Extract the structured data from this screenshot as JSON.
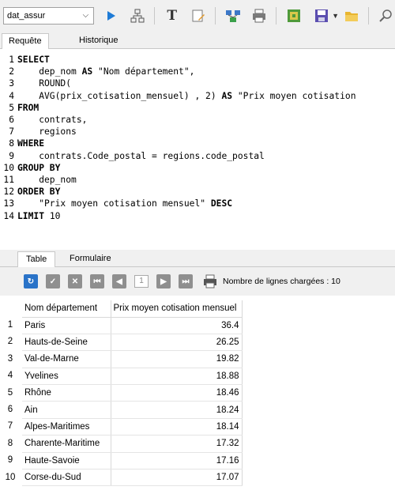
{
  "toolbar": {
    "db_name": "dat_assur",
    "icons": [
      "play-icon",
      "schema-icon",
      "text-icon",
      "clear-icon",
      "query-builder-icon",
      "print-icon",
      "export-icon",
      "save-icon",
      "open-folder-icon",
      "search-icon"
    ]
  },
  "editor_tabs": {
    "request": "Requête",
    "history": "Historique"
  },
  "editor": {
    "lines": [
      {
        "n": "1",
        "parts": [
          {
            "t": "SELECT",
            "k": 1
          }
        ]
      },
      {
        "n": "2",
        "parts": [
          {
            "t": "    dep_nom ",
            "k": 0
          },
          {
            "t": "AS",
            "k": 1
          },
          {
            "t": " \"Nom département\",",
            "k": 0
          }
        ]
      },
      {
        "n": "3",
        "parts": [
          {
            "t": "    ROUND(",
            "k": 0
          }
        ]
      },
      {
        "n": "4",
        "parts": [
          {
            "t": "    AVG(prix_cotisation_mensuel) , 2) ",
            "k": 0
          },
          {
            "t": "AS",
            "k": 1
          },
          {
            "t": " \"Prix moyen cotisation",
            "k": 0
          }
        ]
      },
      {
        "n": "5",
        "parts": [
          {
            "t": "FROM",
            "k": 1
          }
        ]
      },
      {
        "n": "6",
        "parts": [
          {
            "t": "    contrats,",
            "k": 0
          }
        ]
      },
      {
        "n": "7",
        "parts": [
          {
            "t": "    regions",
            "k": 0
          }
        ]
      },
      {
        "n": "8",
        "parts": [
          {
            "t": "WHERE",
            "k": 1
          }
        ]
      },
      {
        "n": "9",
        "parts": [
          {
            "t": "    contrats.Code_postal = regions.code_postal",
            "k": 0
          }
        ]
      },
      {
        "n": "10",
        "parts": [
          {
            "t": "GROUP BY",
            "k": 1
          }
        ]
      },
      {
        "n": "11",
        "parts": [
          {
            "t": "    dep_nom",
            "k": 0
          }
        ]
      },
      {
        "n": "12",
        "parts": [
          {
            "t": "ORDER BY",
            "k": 1
          }
        ]
      },
      {
        "n": "13",
        "parts": [
          {
            "t": "    \"Prix moyen cotisation mensuel\" ",
            "k": 0
          },
          {
            "t": "DESC",
            "k": 1
          }
        ]
      },
      {
        "n": "14",
        "parts": [
          {
            "t": "LIMIT",
            "k": 1
          },
          {
            "t": " 10",
            "k": 0
          }
        ]
      }
    ]
  },
  "result_tabs": {
    "table": "Table",
    "form": "Formulaire"
  },
  "result_toolbar": {
    "page": "1",
    "row_count_label": "Nombre de lignes chargées : 10"
  },
  "results": {
    "columns": [
      "Nom département",
      "Prix moyen cotisation mensuel"
    ],
    "rows": [
      [
        "1",
        "Paris",
        "36.4"
      ],
      [
        "2",
        "Hauts-de-Seine",
        "26.25"
      ],
      [
        "3",
        "Val-de-Marne",
        "19.82"
      ],
      [
        "4",
        "Yvelines",
        "18.88"
      ],
      [
        "5",
        "Rhône",
        "18.46"
      ],
      [
        "6",
        "Ain",
        "18.24"
      ],
      [
        "7",
        "Alpes-Maritimes",
        "18.14"
      ],
      [
        "8",
        "Charente-Maritime",
        "17.32"
      ],
      [
        "9",
        "Haute-Savoie",
        "17.16"
      ],
      [
        "10",
        "Corse-du-Sud",
        "17.07"
      ]
    ]
  }
}
